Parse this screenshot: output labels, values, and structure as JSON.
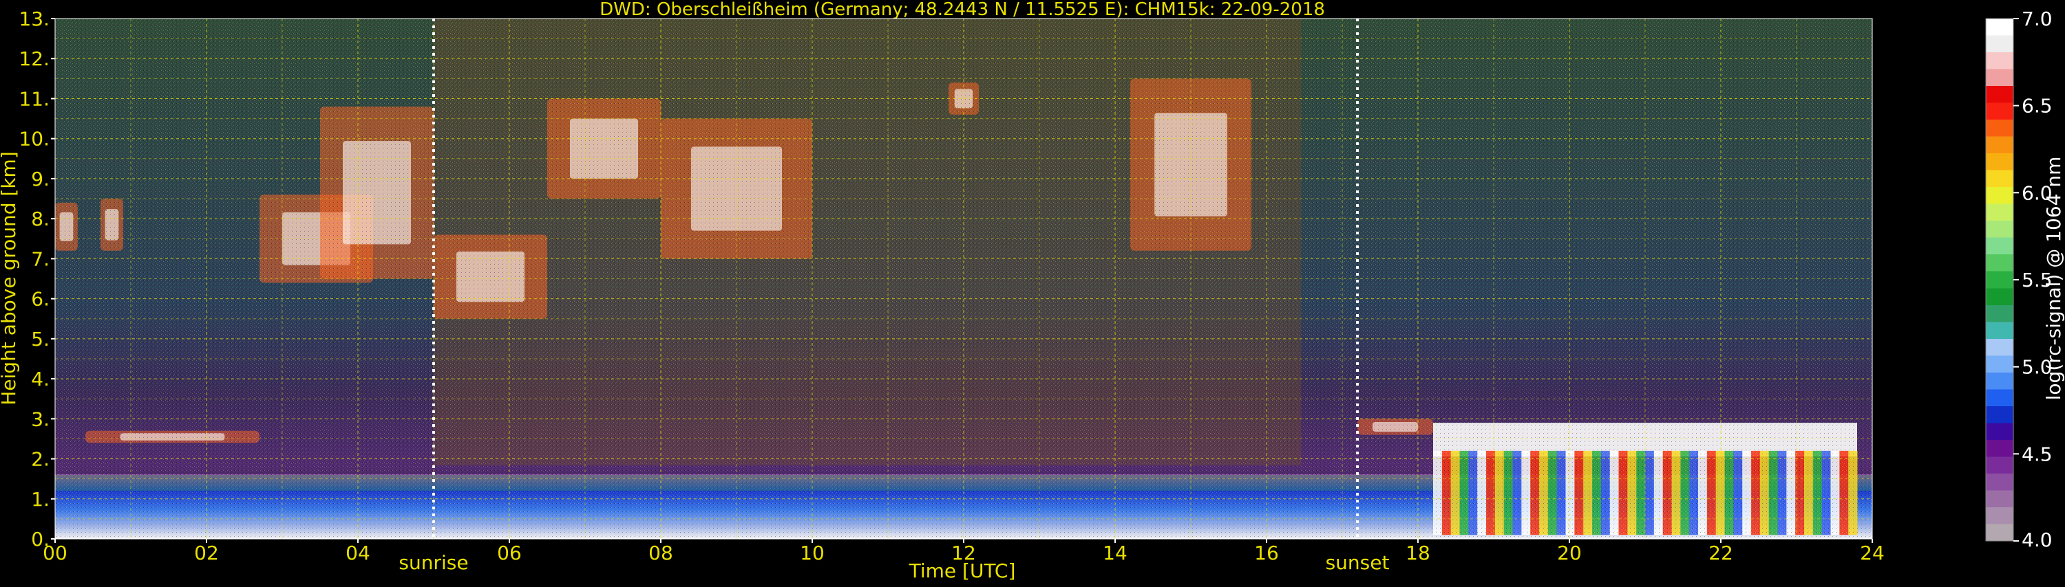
{
  "chart_data": {
    "type": "heatmap",
    "title": "DWD: Oberschleißheim (Germany; 48.2443 N / 11.5525 E):    CHM15k: 22-09-2018",
    "xlabel": "Time [UTC]",
    "ylabel": "Height above ground [km]",
    "xlim": [
      0,
      24
    ],
    "ylim": [
      0,
      13
    ],
    "x_ticks": [
      "00",
      "02",
      "04",
      "06",
      "08",
      "10",
      "12",
      "14",
      "16",
      "18",
      "20",
      "22",
      "24"
    ],
    "y_ticks": [
      "0.",
      "1.",
      "2.",
      "3.",
      "4.",
      "5.",
      "6.",
      "7.",
      "8.",
      "9.",
      "10.",
      "11.",
      "12.",
      "13."
    ],
    "grid": true,
    "markers": [
      {
        "label": "sunrise",
        "x": 5.0
      },
      {
        "label": "sunset",
        "x": 17.2
      }
    ],
    "colorbar": {
      "label": "log(rc-signal) @ 1064 nm",
      "range": [
        4.0,
        7.0
      ],
      "ticks": [
        "4.0",
        "4.5",
        "5.0",
        "5.5",
        "6.0",
        "6.5",
        "7.0"
      ],
      "colors": [
        "#b3a8b0",
        "#a98fad",
        "#9b6fa6",
        "#8c4fa1",
        "#7a2d9a",
        "#6a1090",
        "#3c0aa0",
        "#1030c8",
        "#2060f0",
        "#4a8cf5",
        "#7ab0f8",
        "#a8c8f5",
        "#40b8b0",
        "#30a068",
        "#159a30",
        "#2ab040",
        "#55c860",
        "#80dd90",
        "#a8e878",
        "#c8f060",
        "#e8f030",
        "#f8d820",
        "#f8b010",
        "#f89010",
        "#f86010",
        "#f82010",
        "#e80808",
        "#f0a0a0",
        "#f8c8c8",
        "#eeeeee",
        "#ffffff"
      ]
    },
    "features": [
      {
        "kind": "boundary_layer",
        "x": [
          0,
          24
        ],
        "y": [
          0.0,
          1.6
        ]
      },
      {
        "kind": "cloud",
        "x": [
          0.0,
          0.3
        ],
        "y": [
          7.2,
          8.4
        ]
      },
      {
        "kind": "cloud",
        "x": [
          0.6,
          0.9
        ],
        "y": [
          7.2,
          8.5
        ]
      },
      {
        "kind": "cloud",
        "x": [
          2.7,
          4.2
        ],
        "y": [
          6.4,
          8.6
        ]
      },
      {
        "kind": "cloud",
        "x": [
          3.5,
          5.0
        ],
        "y": [
          6.5,
          10.8
        ]
      },
      {
        "kind": "cloud",
        "x": [
          5.0,
          6.5
        ],
        "y": [
          5.5,
          7.6
        ]
      },
      {
        "kind": "cloud",
        "x": [
          0.4,
          2.7
        ],
        "y": [
          2.4,
          2.7
        ]
      },
      {
        "kind": "cloud",
        "x": [
          6.5,
          8.0
        ],
        "y": [
          8.5,
          11.0
        ]
      },
      {
        "kind": "cloud",
        "x": [
          8.0,
          10.0
        ],
        "y": [
          7.0,
          10.5
        ]
      },
      {
        "kind": "cloud",
        "x": [
          11.8,
          12.2
        ],
        "y": [
          10.6,
          11.4
        ]
      },
      {
        "kind": "cloud",
        "x": [
          14.2,
          15.8
        ],
        "y": [
          7.2,
          11.5
        ]
      },
      {
        "kind": "cloud",
        "x": [
          17.2,
          18.2
        ],
        "y": [
          2.6,
          3.0
        ]
      },
      {
        "kind": "cloud",
        "x": [
          18.2,
          23.8
        ],
        "y": [
          0.1,
          2.9
        ]
      }
    ]
  }
}
